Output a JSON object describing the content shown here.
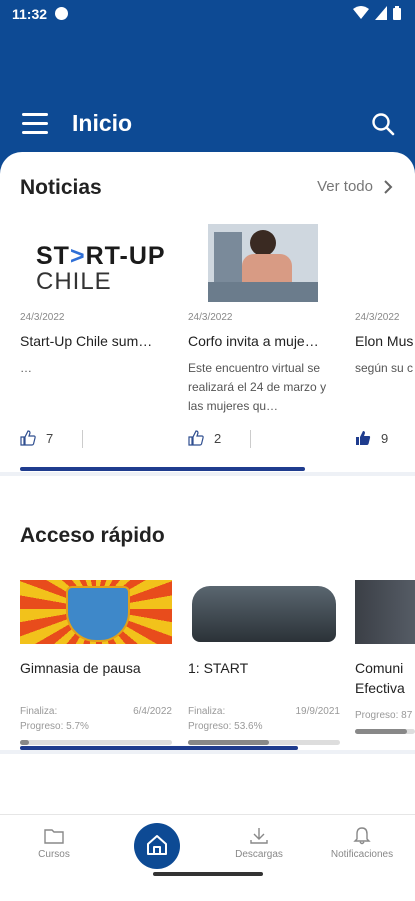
{
  "status": {
    "time": "11:32"
  },
  "header": {
    "title": "Inicio"
  },
  "news": {
    "heading": "Noticias",
    "see_all": "Ver todo",
    "items": [
      {
        "date": "24/3/2022",
        "title": "Start-Up Chile sum…",
        "desc": "…",
        "likes": "7",
        "logo_line1": "ST",
        "logo_line1b": "RT-UP",
        "logo_line2": "CHILE"
      },
      {
        "date": "24/3/2022",
        "title": "Corfo invita a muje…",
        "desc": "Este encuentro virtual se realizará el 24 de marzo y las mujeres qu…",
        "likes": "2"
      },
      {
        "date": "24/3/2022",
        "title": "Elon Mus",
        "desc": "según su c",
        "likes": "9"
      }
    ]
  },
  "quick": {
    "heading": "Acceso rápido",
    "items": [
      {
        "title": "Gimnasia de pausa",
        "end_label": "Finaliza:",
        "end_date": "6/4/2022",
        "progress_label": "Progreso: 5.7%",
        "progress": 0.057
      },
      {
        "title": "1: START",
        "end_label": "Finaliza:",
        "end_date": "19/9/2021",
        "progress_label": "Progreso: 53.6%",
        "progress": 0.536
      },
      {
        "title": "Comuni Efectiva",
        "end_label": "",
        "end_date": "",
        "progress_label": "Progreso: 87",
        "progress": 0.87
      }
    ]
  },
  "nav": {
    "cursos": "Cursos",
    "descargas": "Descargas",
    "notificaciones": "Notificaciones"
  },
  "colors": {
    "primary": "#0d4a94",
    "accent": "#1f3c8e"
  }
}
